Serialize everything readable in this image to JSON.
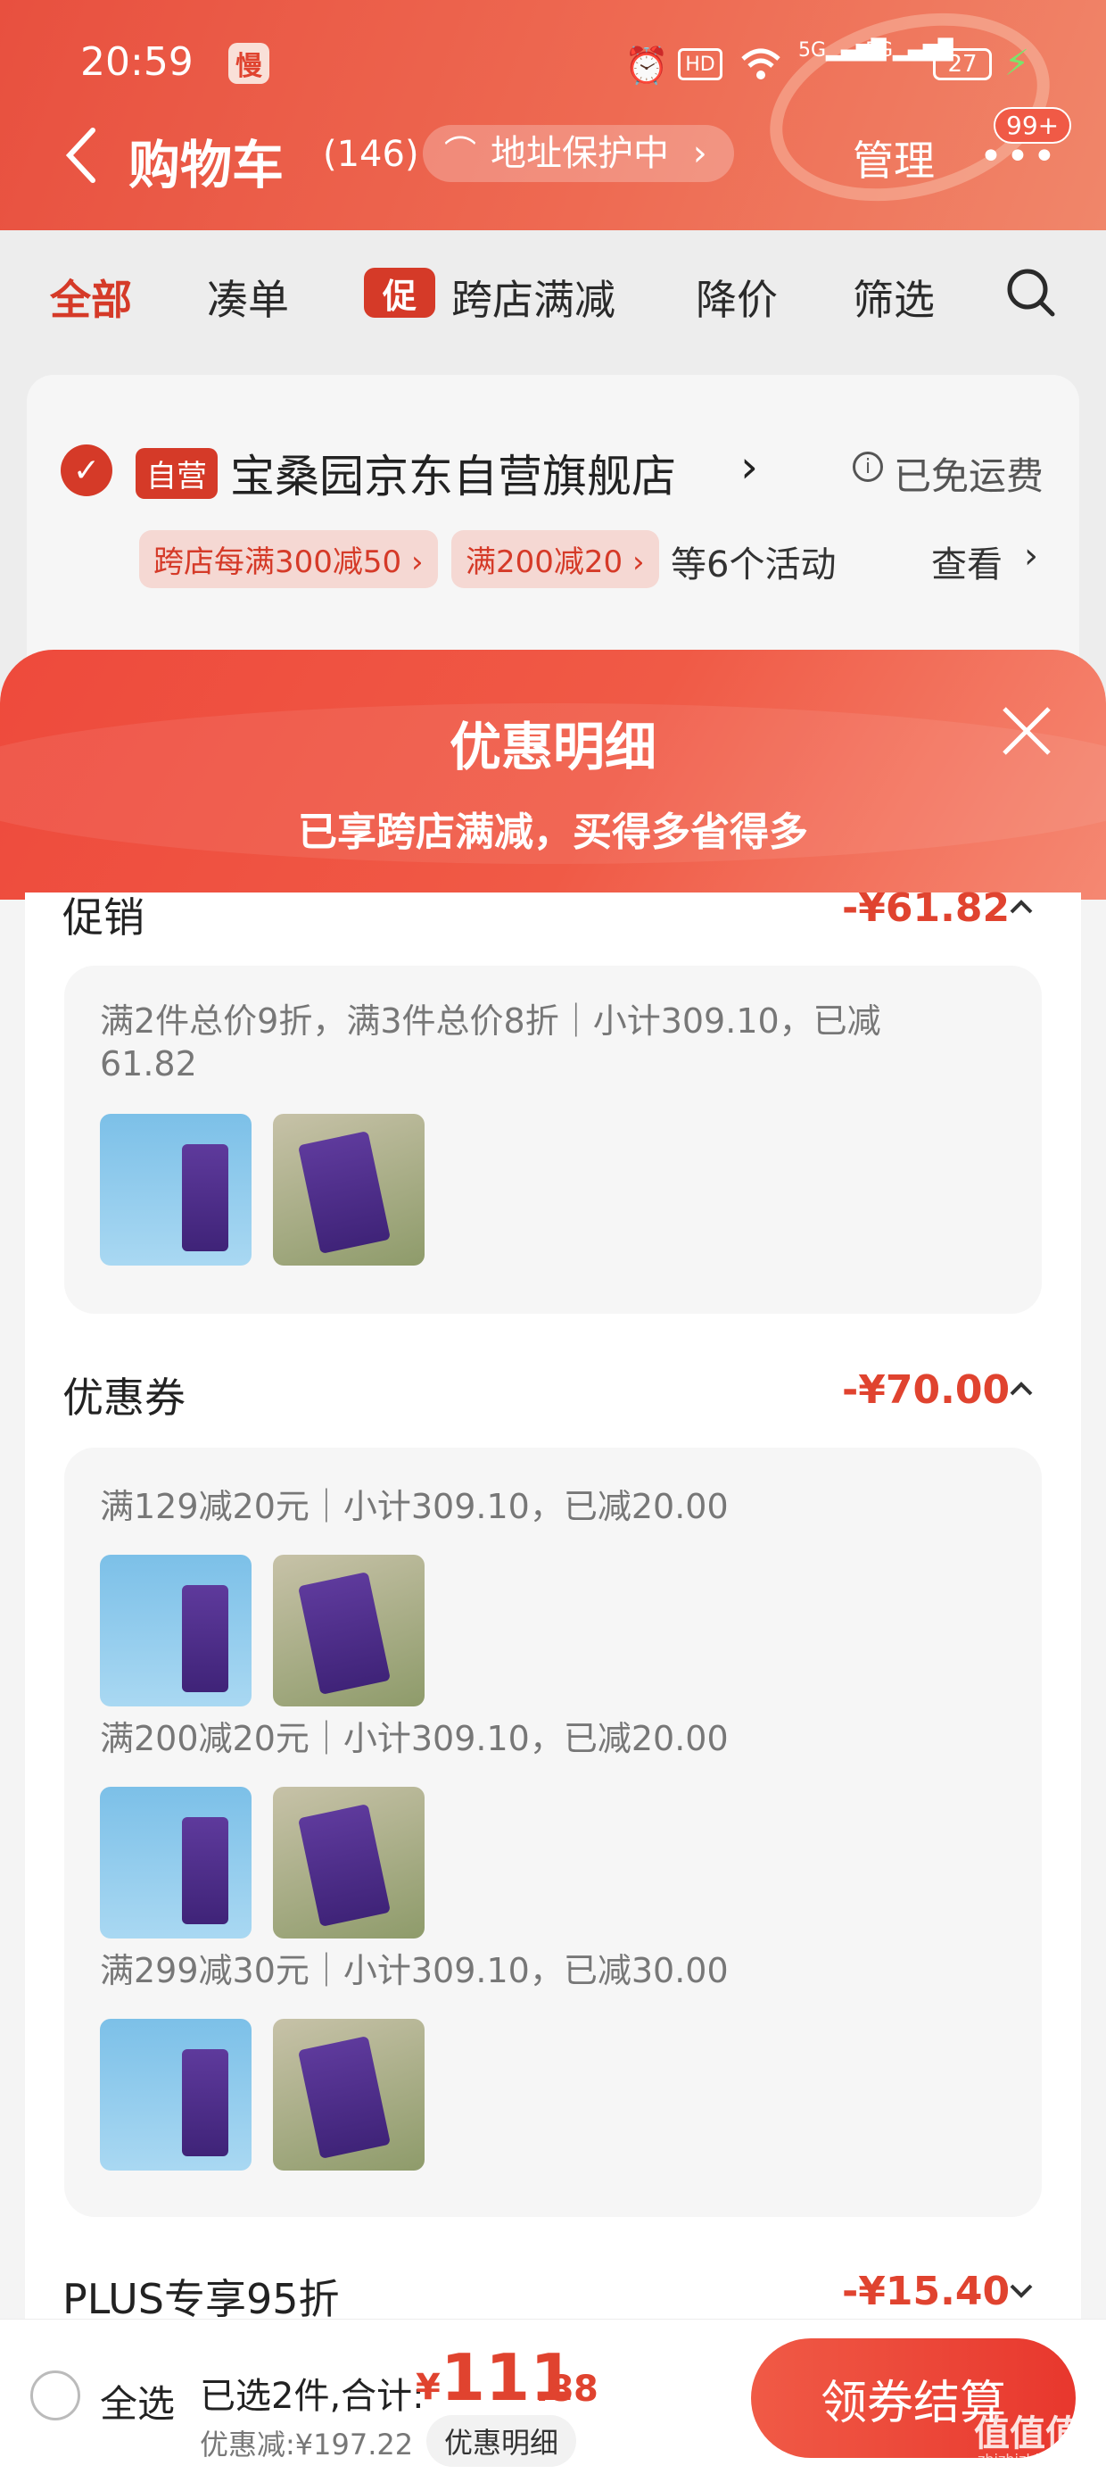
{
  "status_bar": {
    "time": "20:59",
    "app_badge": "慢",
    "network": "5G",
    "battery": "27"
  },
  "header": {
    "back_icon": "chevron-left-icon",
    "title": "购物车",
    "count": "(146)",
    "address_protect": "地址保护中",
    "manage": "管理",
    "badge": "99+"
  },
  "tabs": [
    {
      "label": "全部",
      "active": true
    },
    {
      "label": "凑单"
    },
    {
      "label": "跨店满减",
      "tag": "促"
    },
    {
      "label": "降价"
    },
    {
      "label": "筛选"
    }
  ],
  "shop": {
    "tag": "自营",
    "name": "宝桑园京东自营旗舰店",
    "shipping": "已免运费",
    "promos": [
      "跨店每满300减50 ›",
      "满200减20 ›"
    ],
    "more": "等6个活动",
    "view": "查看"
  },
  "modal": {
    "title": "优惠明细",
    "subtitle": "已享跨店满减，买得多省得多",
    "sections": [
      {
        "title": "促销",
        "amount": "-¥61.82",
        "lines": [
          "满2件总价9折，满3件总价8折｜小计309.10，已减61.82"
        ]
      },
      {
        "title": "优惠券",
        "amount": "-¥70.00",
        "lines": [
          "满129减20元｜小计309.10，已减20.00",
          "满200减20元｜小计309.10，已减20.00",
          "满299减30元｜小计309.10，已减30.00"
        ]
      },
      {
        "title": "PLUS专享95折",
        "amount": "-¥15.40"
      }
    ]
  },
  "bottom": {
    "select_all": "全选",
    "selected_text": "已选2件,合计:",
    "currency": "¥",
    "price_int": "111",
    "price_dec": ".88",
    "discount": "优惠减:¥197.22",
    "detail_button": "优惠明细",
    "checkout": "领券结算",
    "watermark": "值值值",
    "watermark_url": "zhizhizhi.com"
  },
  "colors": {
    "accent": "#e0432f",
    "header": "#ee6a52"
  }
}
